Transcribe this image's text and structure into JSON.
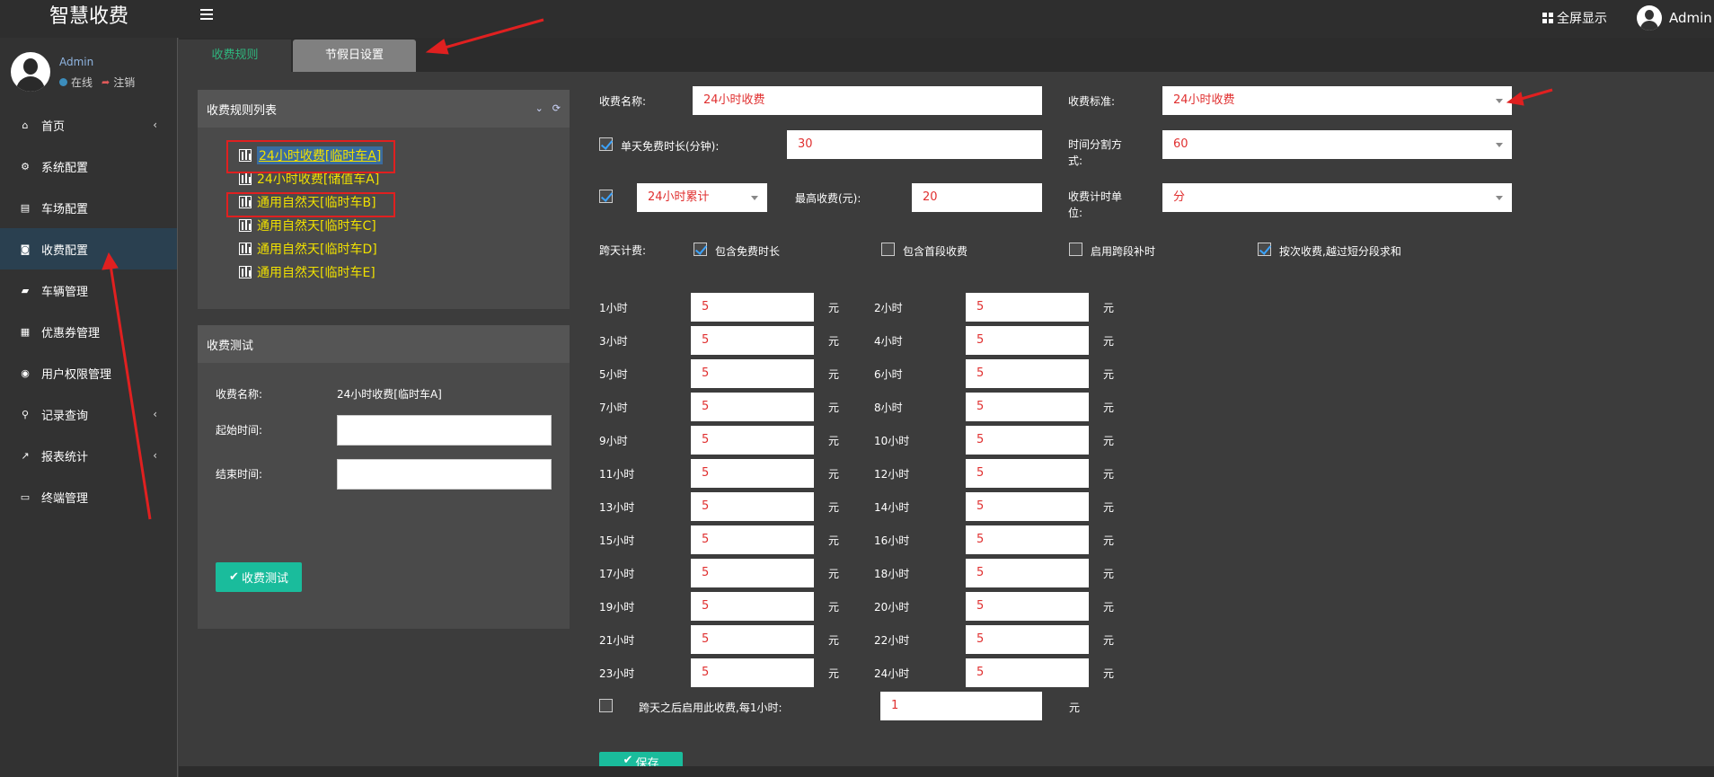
{
  "app": {
    "title": "智慧收费",
    "fullscreen_label": "全屏显示",
    "user": "Admin"
  },
  "profile": {
    "name": "Admin",
    "status": "在线",
    "logout": "注销"
  },
  "menu": [
    {
      "label": "首页",
      "icon": "home-icon",
      "arrow": "‹"
    },
    {
      "label": "系统配置",
      "icon": "cogs-icon"
    },
    {
      "label": "车场配置",
      "icon": "file-icon"
    },
    {
      "label": "收费配置",
      "icon": "money-icon",
      "active": true
    },
    {
      "label": "车辆管理",
      "icon": "car-icon"
    },
    {
      "label": "优惠券管理",
      "icon": "calendar-icon"
    },
    {
      "label": "用户权限管理",
      "icon": "user-circle-icon"
    },
    {
      "label": "记录查询",
      "icon": "search-icon",
      "arrow": "‹"
    },
    {
      "label": "报表统计",
      "icon": "line-chart-icon",
      "arrow": "‹"
    },
    {
      "label": "终端管理",
      "icon": "monitor-icon"
    }
  ],
  "tabs": {
    "fee_rules": "收费规则",
    "holiday": "节假日设置"
  },
  "rule_list": {
    "title": "收费规则列表",
    "items": [
      "24小时收费[临时车A]",
      "24小时收费[储值车A]",
      "通用自然天[临时车B]",
      "通用自然天[临时车C]",
      "通用自然天[临时车D]",
      "通用自然天[临时车E]"
    ],
    "selected": "24小时收费[临时车A]"
  },
  "fee_test": {
    "title": "收费测试",
    "name_label": "收费名称:",
    "name_value": "24小时收费[临时车A]",
    "start_label": "起始时间:",
    "end_label": "结束时间:",
    "button": "收费测试"
  },
  "form": {
    "name_label": "收费名称:",
    "name_value": "24小时收费",
    "standard_label": "收费标准:",
    "standard_value": "24小时收费",
    "free_label": "单天免费时长(分钟):",
    "free_value": "30",
    "split_label": "时间分割方式:",
    "split_value": "60",
    "mode_value": "24小时累计",
    "max_label": "最高收费(元):",
    "max_value": "20",
    "unit_label": "收费计时单位:",
    "unit_value": "分",
    "crossday_label": "跨天计费:",
    "opt_include_free": "包含免费时长",
    "opt_include_first": "包含首段收费",
    "opt_cross_supplement": "启用跨段补时",
    "opt_per_time": "按次收费,越过短分段求和",
    "after_label": "跨天之后启用此收费,每1小时:",
    "after_value": "1",
    "currency": "元",
    "save": "保存"
  },
  "hours": [
    {
      "label": "1小时",
      "value": "5"
    },
    {
      "label": "2小时",
      "value": "5"
    },
    {
      "label": "3小时",
      "value": "5"
    },
    {
      "label": "4小时",
      "value": "5"
    },
    {
      "label": "5小时",
      "value": "5"
    },
    {
      "label": "6小时",
      "value": "5"
    },
    {
      "label": "7小时",
      "value": "5"
    },
    {
      "label": "8小时",
      "value": "5"
    },
    {
      "label": "9小时",
      "value": "5"
    },
    {
      "label": "10小时",
      "value": "5"
    },
    {
      "label": "11小时",
      "value": "5"
    },
    {
      "label": "12小时",
      "value": "5"
    },
    {
      "label": "13小时",
      "value": "5"
    },
    {
      "label": "14小时",
      "value": "5"
    },
    {
      "label": "15小时",
      "value": "5"
    },
    {
      "label": "16小时",
      "value": "5"
    },
    {
      "label": "17小时",
      "value": "5"
    },
    {
      "label": "18小时",
      "value": "5"
    },
    {
      "label": "19小时",
      "value": "5"
    },
    {
      "label": "20小时",
      "value": "5"
    },
    {
      "label": "21小时",
      "value": "5"
    },
    {
      "label": "22小时",
      "value": "5"
    },
    {
      "label": "23小时",
      "value": "5"
    },
    {
      "label": "24小时",
      "value": "5"
    }
  ],
  "colors": {
    "accent_green": "#1abc9c",
    "value_red": "#e03030",
    "tree_yellow": "#f0e000",
    "annotation_red": "#e02020"
  }
}
